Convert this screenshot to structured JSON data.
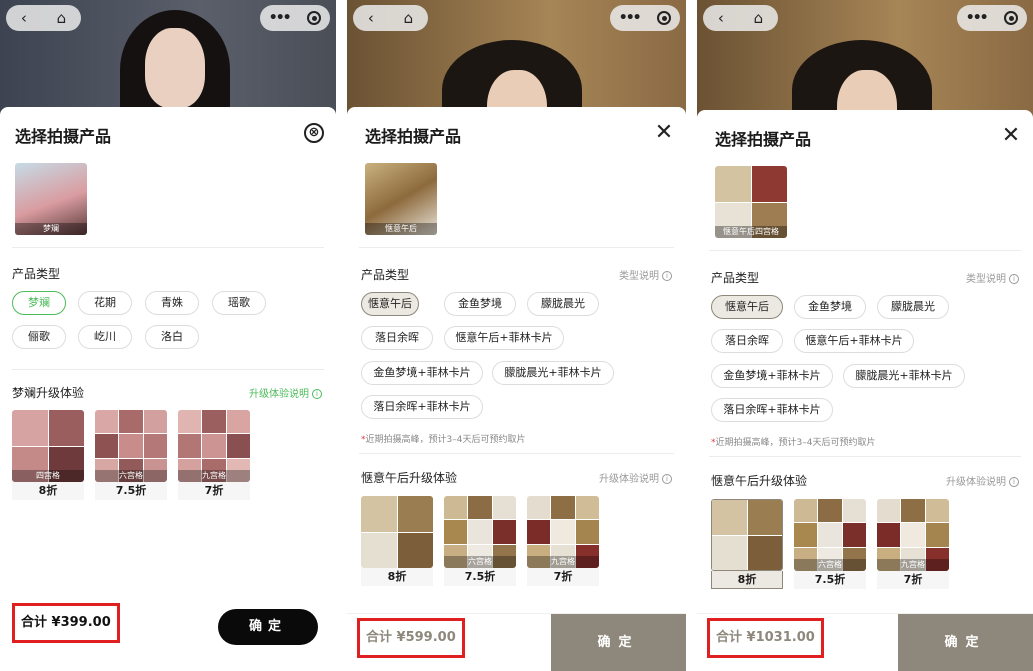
{
  "colors": {
    "green": "#4cbb5b",
    "taupe": "#8e887c",
    "black": "#0a0a0a",
    "highlight_red": "#e02020"
  },
  "nav": {
    "back_icon": "‹",
    "home_icon": "⌂",
    "more_icon": "•••"
  },
  "panels": [
    {
      "title": "选择拍摄产品",
      "close_icon": "⊗",
      "product": {
        "caption": "梦斓"
      },
      "type_label": "产品类型",
      "type_help": "",
      "chips": [
        "梦斓",
        "花期",
        "青姝",
        "瑶歌",
        "俪歌",
        "屹川",
        "洛白"
      ],
      "note": "",
      "upgrade_label": "梦斓升级体验",
      "upgrade_help": "升级体验说明",
      "upgrades": [
        {
          "caption": "四宫格",
          "discount": "8折"
        },
        {
          "caption": "六宫格",
          "discount": "7.5折"
        },
        {
          "caption": "九宫格",
          "discount": "7折"
        }
      ],
      "total": "合计 ¥399.00",
      "confirm": "确定"
    },
    {
      "title": "选择拍摄产品",
      "close_icon": "✕",
      "product": {
        "caption": "惬意午后"
      },
      "type_label": "产品类型",
      "type_help": "类型说明",
      "chips": [
        "惬意午后",
        "金鱼梦境",
        "朦胧晨光",
        "落日余晖",
        "惬意午后+菲林卡片",
        "金鱼梦境+菲林卡片",
        "朦胧晨光+菲林卡片",
        "落日余晖+菲林卡片"
      ],
      "note_star": "*",
      "note": "近期拍摄高峰，预计3–4天后可预约取片",
      "upgrade_label": "惬意午后升级体验",
      "upgrade_help": "升级体验说明",
      "upgrades": [
        {
          "caption": "",
          "discount": "8折"
        },
        {
          "caption": "六宫格",
          "discount": "7.5折"
        },
        {
          "caption": "九宫格",
          "discount": "7折"
        }
      ],
      "total": "合计 ¥599.00",
      "confirm": "确定"
    },
    {
      "title": "选择拍摄产品",
      "close_icon": "✕",
      "product": {
        "caption": "惬意午后四宫格"
      },
      "type_label": "产品类型",
      "type_help": "类型说明",
      "chips": [
        "惬意午后",
        "金鱼梦境",
        "朦胧晨光",
        "落日余晖",
        "惬意午后+菲林卡片",
        "金鱼梦境+菲林卡片",
        "朦胧晨光+菲林卡片",
        "落日余晖+菲林卡片"
      ],
      "note_star": "*",
      "note": "近期拍摄高峰，预计3–4天后可预约取片",
      "upgrade_label": "惬意午后升级体验",
      "upgrade_help": "升级体验说明",
      "upgrades": [
        {
          "caption": "",
          "discount": "8折"
        },
        {
          "caption": "六宫格",
          "discount": "7.5折"
        },
        {
          "caption": "九宫格",
          "discount": "7折"
        }
      ],
      "total": "合计 ¥1031.00",
      "confirm": "确定"
    }
  ]
}
